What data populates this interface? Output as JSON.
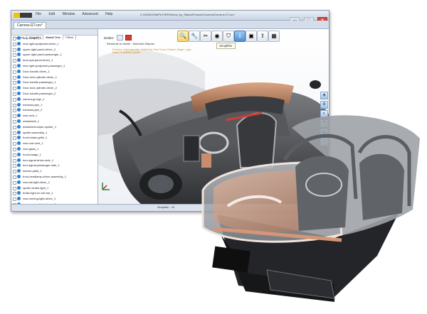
{
  "window": {
    "menu": [
      "File",
      "Edit",
      "Window",
      "Advanced",
      "Help"
    ],
    "title": "C:\\DEMO\\SIMPLIFIER\\Select_by_Status\\Porsche\\Carrera\\Carrera-GT.csv*",
    "buttons": {
      "minimize": "—",
      "maximize": "□",
      "close": "✕"
    },
    "doc_tab": "Carrera-GT.csv*",
    "status": "Simplifier : 15"
  },
  "left_panel": {
    "tabs": [
      "Explorer",
      "Simplifier",
      "Model Tree",
      "Filters"
    ],
    "active_tab": "Model Tree",
    "tree": [
      "rear-bumper_1",
      "rear-right-spotpanel-driver_1",
      "upper-right-panel-driver_2",
      "upper-right-panel-passenger_1",
      "door-spit-panel-driver_1",
      "rear-right-spotpanel-passenger_1",
      "Door-handle-driver_1",
      "Door-lock-cylinder-driver_1",
      "Door-handle-passenger_1",
      "Door-lock-cylinder-driver_2",
      "Door-handle-passenger_2",
      "carrera-gt-logo_1",
      "exhaust-pipe_1",
      "exhaust-pipe_2",
      "rear-vent_1",
      "windshield_1",
      "windshield-wiper-spoiler_1",
      "spoiler-assembly_1",
      "front-intake-grille_1",
      "rear-roof-vent_1",
      "rear-glass_1",
      "hood-badge_1",
      "turn-signal-driver-side_1",
      "turn-signal-passenger-side_1",
      "license-plate_1",
      "front-headlamp-driver-assembly_1",
      "rear-tail-light-driver_1",
      "spoiler-brake-light_1",
      "brake-light-on-roll-bar_1",
      "rear-running-light-driver_1",
      "rear-running-light-driver_2",
      "Mirror-front-headlamp-driver-assembly_1",
      "wheel-assembly-Front(1)_1",
      "wheel-assembly-Front(2)_1",
      "wheel-assembly-Front(3)_1"
    ]
  },
  "viewport": {
    "delete_label": "Delete:",
    "hint": "Elements to delete : Selected Objects",
    "detail": "Exteriors: Solid assembly, Solid Body, Face Count, Feature, Shape, Layer, Mode, Coordinate System",
    "tooltip": "Simplifier"
  },
  "toolbar": {
    "icons": [
      "search-icon",
      "wrench-icon",
      "scissors-icon",
      "camera-icon",
      "shield-icon",
      "download-icon",
      "layers-icon",
      "export-icon",
      "grid-icon"
    ],
    "glyphs": [
      "🔍",
      "🔧",
      "✂",
      "◉",
      "⛉",
      "⇩",
      "▣",
      "⇪",
      "▦"
    ]
  },
  "side_tools": [
    "◈",
    "⚙",
    "◐",
    "⚑",
    "⬓",
    "✓"
  ],
  "colors": {
    "accent": "#2f7fd0",
    "logo": "#f5c400",
    "close": "#d9453b",
    "leather": "#c08060"
  }
}
